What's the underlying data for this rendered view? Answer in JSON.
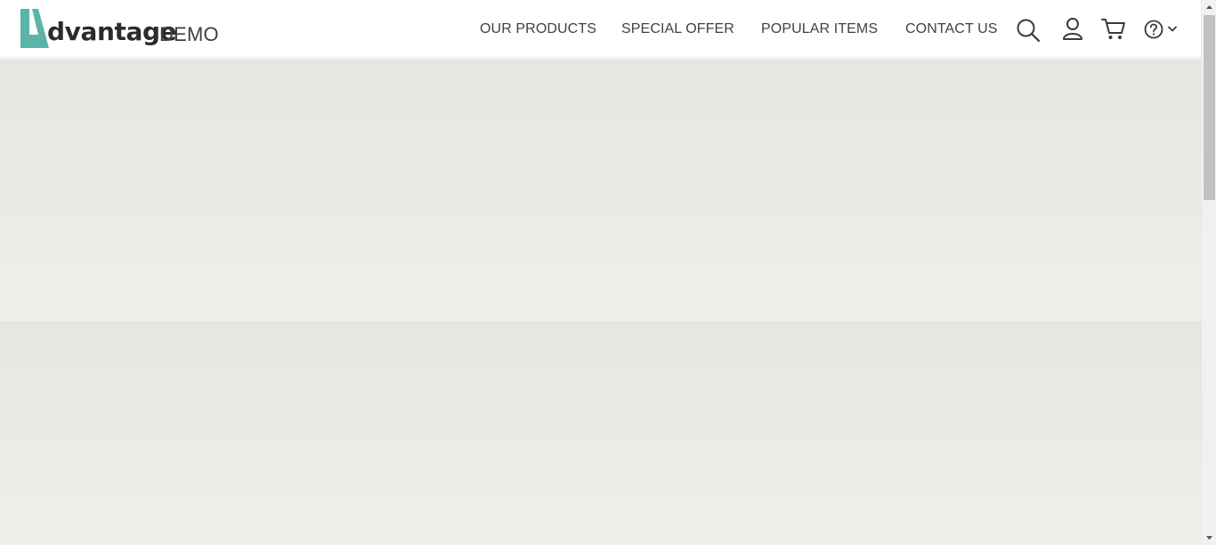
{
  "brand": {
    "word": "dvantage",
    "suffix": "DEMO",
    "accent_color": "#5ab4a8"
  },
  "nav": {
    "items": [
      {
        "label": "OUR PRODUCTS"
      },
      {
        "label": "SPECIAL OFFER"
      },
      {
        "label": "POPULAR ITEMS"
      },
      {
        "label": "CONTACT US"
      }
    ]
  },
  "header_icons": [
    "search-icon",
    "user-icon",
    "cart-icon",
    "help-icon",
    "chevron-down-icon"
  ],
  "colors": {
    "nav_text": "#414141",
    "background": "#e9e8e3"
  }
}
